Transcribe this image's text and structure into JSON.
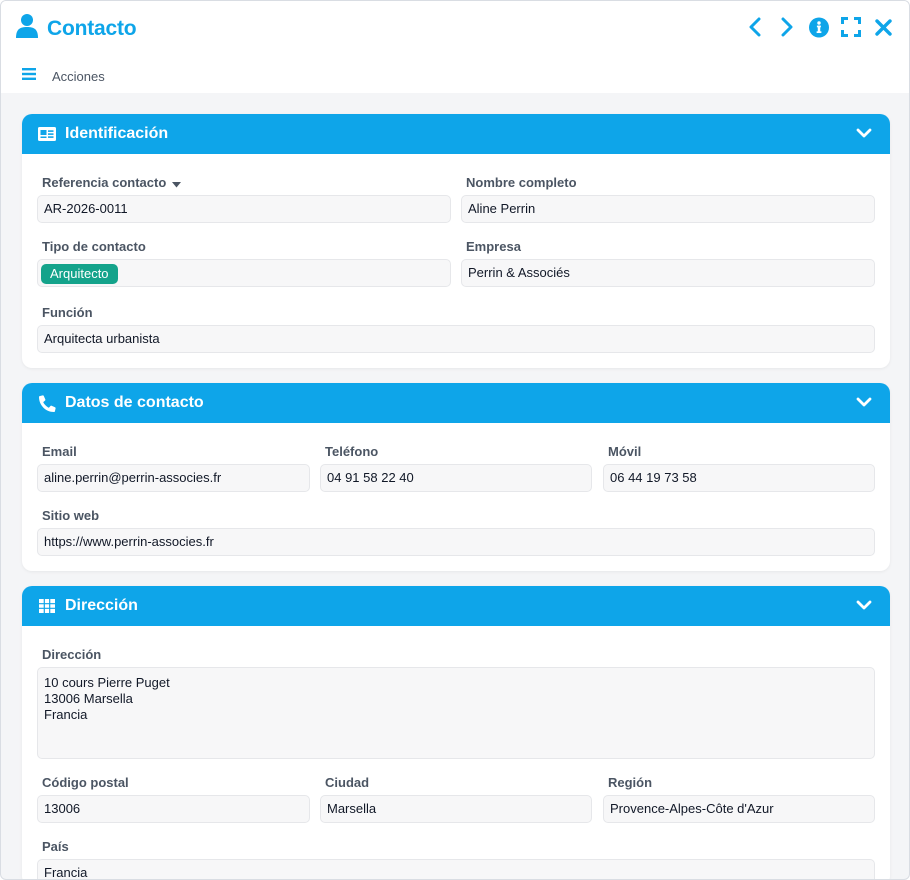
{
  "window": {
    "title": "Contacto",
    "icons": [
      "user-icon",
      "chevron-left-icon",
      "chevron-right-icon",
      "info-icon",
      "expand-icon",
      "close-icon"
    ],
    "accent": "#0ea5e9"
  },
  "actions": {
    "label": "Acciones",
    "icon": "menu-icon"
  },
  "identification": {
    "title": "Identificación",
    "icon": "id-card-icon",
    "reference_label": "Referencia contacto",
    "reference_value": "AR-2026-0011",
    "fullname_label": "Nombre completo",
    "fullname_value": "Aline Perrin",
    "type_label": "Tipo de contacto",
    "type_value": "Arquitecto",
    "type_color": "#14a38b",
    "company_label": "Empresa",
    "company_value": "Perrin & Associés",
    "function_label": "Función",
    "function_value": "Arquitecta urbanista"
  },
  "contact": {
    "title": "Datos de contacto",
    "icon": "phone-icon",
    "email_label": "Email",
    "email_value": "aline.perrin@perrin-associes.fr",
    "phone_label": "Teléfono",
    "phone_value": "04 91 58 22 40",
    "mobile_label": "Móvil",
    "mobile_value": "06 44 19 73 58",
    "web_label": "Sitio web",
    "web_value": "https://www.perrin-associes.fr"
  },
  "address": {
    "title": "Dirección",
    "icon": "grid-icon",
    "address_label": "Dirección",
    "address_value": "10 cours Pierre Puget\n13006 Marsella\nFrancia",
    "postal_label": "Código postal",
    "postal_value": "13006",
    "city_label": "Ciudad",
    "city_value": "Marsella",
    "region_label": "Región",
    "region_value": "Provence-Alpes-Côte d'Azur",
    "country_label": "País",
    "country_value": "Francia"
  }
}
